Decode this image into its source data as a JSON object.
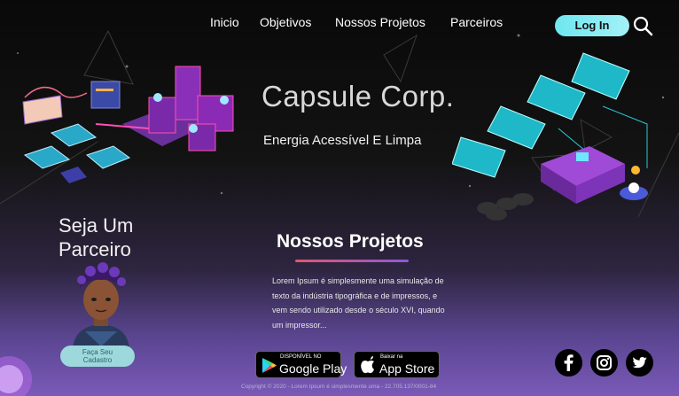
{
  "nav": {
    "items": [
      {
        "label": "Inicio"
      },
      {
        "label": "Objetivos"
      },
      {
        "label": "Nossos Projetos"
      },
      {
        "label": "Parceiros"
      }
    ],
    "login_label": "Log In",
    "search_icon": "search-icon"
  },
  "hero": {
    "title": "Capsule Corp.",
    "subtitle": "Energia Acessível E Limpa"
  },
  "partner": {
    "heading": "Seja Um Parceiro",
    "signup_line1": "Faça Seu",
    "signup_line2": "Cadastro"
  },
  "projects": {
    "heading": "Nossos Projetos",
    "body": "Lorem Ipsum é simplesmente uma simulação de texto da indústria tipográfica e de impressos, e vem sendo utilizado desde o século XVI, quando um impressor..."
  },
  "stores": {
    "google_small": "DISPONÍVEL NO",
    "google_big": "Google Play",
    "apple_small": "Baixar na",
    "apple_big": "App Store"
  },
  "social": {
    "icons": [
      "facebook-icon",
      "instagram-icon",
      "twitter-icon"
    ]
  },
  "footer": {
    "text": "Copyright © 2020 - Lorem Ipsum é simplesmente uma - 22.705.137/0001-84"
  },
  "colors": {
    "accent_cyan": "#6fe6f0",
    "accent_purple": "#8a5ad8",
    "accent_pink": "#e2566e"
  }
}
